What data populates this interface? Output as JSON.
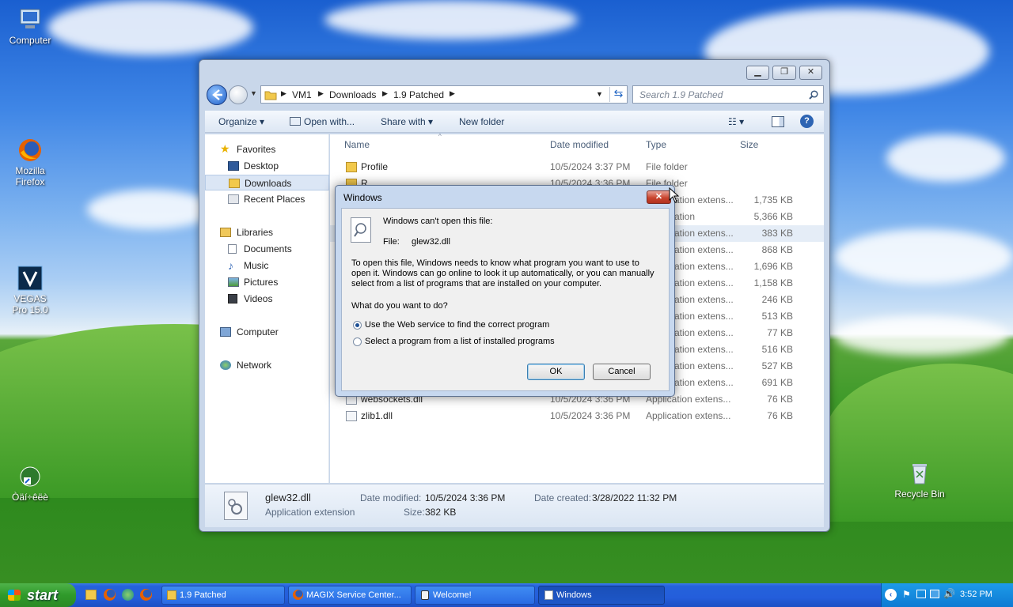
{
  "desktop": {
    "icons": [
      {
        "label": "Computer"
      },
      {
        "label": "Mozilla Firefox"
      },
      {
        "label": "VEGAS Pro 15.0"
      },
      {
        "label": "Òäí÷êëè"
      },
      {
        "label": "Recycle Bin"
      }
    ]
  },
  "explorer": {
    "breadcrumb": [
      "VM1",
      "Downloads",
      "1.9 Patched"
    ],
    "search_placeholder": "Search 1.9 Patched",
    "toolbar": {
      "organize": "Organize",
      "open_with": "Open with...",
      "share_with": "Share with",
      "new_folder": "New folder"
    },
    "nav": {
      "favorites": "Favorites",
      "desktop": "Desktop",
      "downloads": "Downloads",
      "recent": "Recent Places",
      "libraries": "Libraries",
      "documents": "Documents",
      "music": "Music",
      "pictures": "Pictures",
      "videos": "Videos",
      "computer": "Computer",
      "network": "Network"
    },
    "columns": {
      "name": "Name",
      "date": "Date modified",
      "type": "Type",
      "size": "Size"
    },
    "rows": [
      {
        "name": "Profile",
        "date": "10/5/2024 3:37 PM",
        "type": "File folder",
        "size": ""
      },
      {
        "name": "R...",
        "date": "10/5/2024 3:36 PM",
        "type": "File folder",
        "size": ""
      },
      {
        "name": "",
        "date": "",
        "type": "ation extens...",
        "size": "1,735 KB"
      },
      {
        "name": "",
        "date": "",
        "type": "ation",
        "size": "5,366 KB"
      },
      {
        "name": "",
        "date": "",
        "type": "ation extens...",
        "size": "383 KB"
      },
      {
        "name": "",
        "date": "",
        "type": "ation extens...",
        "size": "868 KB"
      },
      {
        "name": "",
        "date": "",
        "type": "ation extens...",
        "size": "1,696 KB"
      },
      {
        "name": "",
        "date": "",
        "type": "ation extens...",
        "size": "1,158 KB"
      },
      {
        "name": "",
        "date": "",
        "type": "ation extens...",
        "size": "246 KB"
      },
      {
        "name": "",
        "date": "",
        "type": "ation extens...",
        "size": "513 KB"
      },
      {
        "name": "",
        "date": "",
        "type": "ation extens...",
        "size": "77 KB"
      },
      {
        "name": "",
        "date": "",
        "type": "ation extens...",
        "size": "516 KB"
      },
      {
        "name": "",
        "date": "",
        "type": "ation extens...",
        "size": "527 KB"
      },
      {
        "name": "",
        "date": "",
        "type": "ation extens...",
        "size": "691 KB"
      },
      {
        "name": "websockets.dll",
        "date": "10/5/2024 3:36 PM",
        "type": "Application extens...",
        "size": "76 KB"
      },
      {
        "name": "zlib1.dll",
        "date": "10/5/2024 3:36 PM",
        "type": "Application extens...",
        "size": "76 KB"
      }
    ],
    "details": {
      "filename": "glew32.dll",
      "filetype": "Application extension",
      "date_modified_label": "Date modified:",
      "date_modified": "10/5/2024 3:36 PM",
      "date_created_label": "Date created:",
      "date_created": "3/28/2022 11:32 PM",
      "size_label": "Size:",
      "size": "382 KB"
    }
  },
  "dialog": {
    "title": "Windows",
    "heading": "Windows can't open this file:",
    "file_label": "File:",
    "file_name": "glew32.dll",
    "body_line1": "To open this file, Windows needs to know what program you want to use to",
    "body_line2": "open it. Windows can go online to look it up automatically, or you can manually",
    "body_line3": "select from a list of programs that are installed on your computer.",
    "question": "What do you want to do?",
    "option_web": "Use the Web service to find the correct program",
    "option_list": "Select a program from a list of installed programs",
    "selected_option": "web",
    "ok": "OK",
    "cancel": "Cancel"
  },
  "taskbar": {
    "start": "start",
    "buttons": [
      {
        "label": "1.9 Patched"
      },
      {
        "label": "MAGIX Service Center..."
      },
      {
        "label": "Welcome!"
      },
      {
        "label": "Windows"
      }
    ],
    "clock": "3:52 PM"
  }
}
